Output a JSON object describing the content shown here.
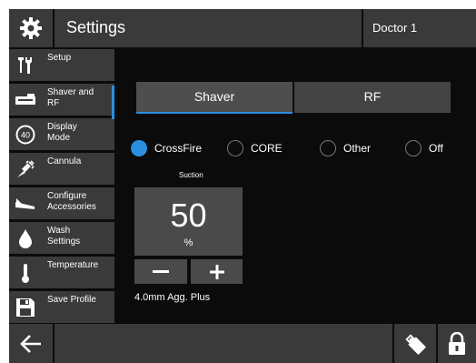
{
  "header": {
    "title": "Settings",
    "user": "Doctor 1",
    "settings_icon": "gear-icon"
  },
  "sidebar": {
    "items": [
      {
        "label": "Setup",
        "icon": "tools-icon"
      },
      {
        "label": "Shaver and\nRF",
        "icon": "shaver-icon",
        "active": true
      },
      {
        "label": "Display\nMode",
        "icon": "display-mode-icon"
      },
      {
        "label": "Cannula",
        "icon": "cannula-icon"
      },
      {
        "label": "Configure\nAccessories",
        "icon": "accessories-icon"
      },
      {
        "label": "Wash\nSettings",
        "icon": "water-drop-icon"
      },
      {
        "label": "Temperature",
        "icon": "thermometer-icon"
      },
      {
        "label": "Save Profile",
        "icon": "save-icon"
      }
    ],
    "display_mode_badge": "40"
  },
  "main": {
    "tabs": [
      {
        "label": "Shaver",
        "selected": true
      },
      {
        "label": "RF",
        "selected": false
      }
    ],
    "modes": [
      {
        "label": "CrossFire",
        "checked": true
      },
      {
        "label": "CORE",
        "checked": false
      },
      {
        "label": "Other",
        "checked": false
      },
      {
        "label": "Off",
        "checked": false
      }
    ],
    "suction": {
      "label": "Suction",
      "value": "50",
      "unit": "%"
    },
    "blade": "4.0mm Agg. Plus"
  },
  "footer": {
    "back_icon": "back-arrow-icon",
    "usb_icon": "usb-drive-icon",
    "lock_icon": "lock-icon"
  },
  "colors": {
    "accent": "#2a8fe0",
    "panel": "#3a3a3a",
    "background": "#0b0b0b",
    "control": "#4a4a4a"
  }
}
